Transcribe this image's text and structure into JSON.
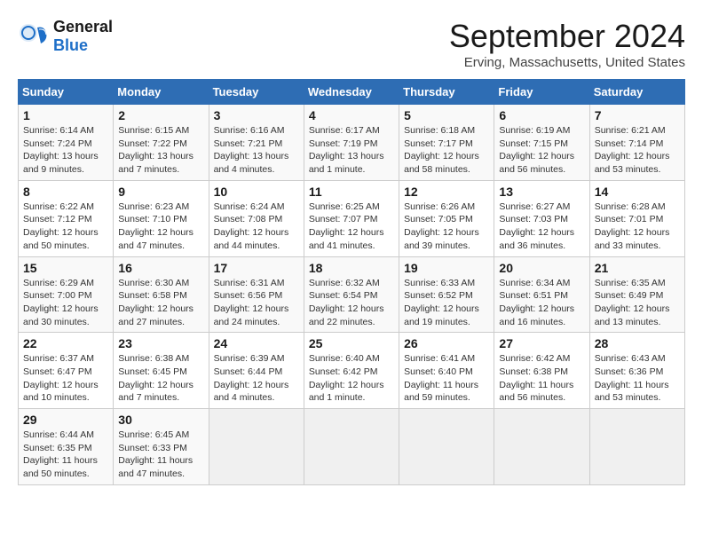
{
  "header": {
    "logo_general": "General",
    "logo_blue": "Blue",
    "month_title": "September 2024",
    "location": "Erving, Massachusetts, United States"
  },
  "days_of_week": [
    "Sunday",
    "Monday",
    "Tuesday",
    "Wednesday",
    "Thursday",
    "Friday",
    "Saturday"
  ],
  "weeks": [
    [
      {
        "num": "1",
        "sunrise": "6:14 AM",
        "sunset": "7:24 PM",
        "daylight": "13 hours and 9 minutes."
      },
      {
        "num": "2",
        "sunrise": "6:15 AM",
        "sunset": "7:22 PM",
        "daylight": "13 hours and 7 minutes."
      },
      {
        "num": "3",
        "sunrise": "6:16 AM",
        "sunset": "7:21 PM",
        "daylight": "13 hours and 4 minutes."
      },
      {
        "num": "4",
        "sunrise": "6:17 AM",
        "sunset": "7:19 PM",
        "daylight": "13 hours and 1 minute."
      },
      {
        "num": "5",
        "sunrise": "6:18 AM",
        "sunset": "7:17 PM",
        "daylight": "12 hours and 58 minutes."
      },
      {
        "num": "6",
        "sunrise": "6:19 AM",
        "sunset": "7:15 PM",
        "daylight": "12 hours and 56 minutes."
      },
      {
        "num": "7",
        "sunrise": "6:21 AM",
        "sunset": "7:14 PM",
        "daylight": "12 hours and 53 minutes."
      }
    ],
    [
      {
        "num": "8",
        "sunrise": "6:22 AM",
        "sunset": "7:12 PM",
        "daylight": "12 hours and 50 minutes."
      },
      {
        "num": "9",
        "sunrise": "6:23 AM",
        "sunset": "7:10 PM",
        "daylight": "12 hours and 47 minutes."
      },
      {
        "num": "10",
        "sunrise": "6:24 AM",
        "sunset": "7:08 PM",
        "daylight": "12 hours and 44 minutes."
      },
      {
        "num": "11",
        "sunrise": "6:25 AM",
        "sunset": "7:07 PM",
        "daylight": "12 hours and 41 minutes."
      },
      {
        "num": "12",
        "sunrise": "6:26 AM",
        "sunset": "7:05 PM",
        "daylight": "12 hours and 39 minutes."
      },
      {
        "num": "13",
        "sunrise": "6:27 AM",
        "sunset": "7:03 PM",
        "daylight": "12 hours and 36 minutes."
      },
      {
        "num": "14",
        "sunrise": "6:28 AM",
        "sunset": "7:01 PM",
        "daylight": "12 hours and 33 minutes."
      }
    ],
    [
      {
        "num": "15",
        "sunrise": "6:29 AM",
        "sunset": "7:00 PM",
        "daylight": "12 hours and 30 minutes."
      },
      {
        "num": "16",
        "sunrise": "6:30 AM",
        "sunset": "6:58 PM",
        "daylight": "12 hours and 27 minutes."
      },
      {
        "num": "17",
        "sunrise": "6:31 AM",
        "sunset": "6:56 PM",
        "daylight": "12 hours and 24 minutes."
      },
      {
        "num": "18",
        "sunrise": "6:32 AM",
        "sunset": "6:54 PM",
        "daylight": "12 hours and 22 minutes."
      },
      {
        "num": "19",
        "sunrise": "6:33 AM",
        "sunset": "6:52 PM",
        "daylight": "12 hours and 19 minutes."
      },
      {
        "num": "20",
        "sunrise": "6:34 AM",
        "sunset": "6:51 PM",
        "daylight": "12 hours and 16 minutes."
      },
      {
        "num": "21",
        "sunrise": "6:35 AM",
        "sunset": "6:49 PM",
        "daylight": "12 hours and 13 minutes."
      }
    ],
    [
      {
        "num": "22",
        "sunrise": "6:37 AM",
        "sunset": "6:47 PM",
        "daylight": "12 hours and 10 minutes."
      },
      {
        "num": "23",
        "sunrise": "6:38 AM",
        "sunset": "6:45 PM",
        "daylight": "12 hours and 7 minutes."
      },
      {
        "num": "24",
        "sunrise": "6:39 AM",
        "sunset": "6:44 PM",
        "daylight": "12 hours and 4 minutes."
      },
      {
        "num": "25",
        "sunrise": "6:40 AM",
        "sunset": "6:42 PM",
        "daylight": "12 hours and 1 minute."
      },
      {
        "num": "26",
        "sunrise": "6:41 AM",
        "sunset": "6:40 PM",
        "daylight": "11 hours and 59 minutes."
      },
      {
        "num": "27",
        "sunrise": "6:42 AM",
        "sunset": "6:38 PM",
        "daylight": "11 hours and 56 minutes."
      },
      {
        "num": "28",
        "sunrise": "6:43 AM",
        "sunset": "6:36 PM",
        "daylight": "11 hours and 53 minutes."
      }
    ],
    [
      {
        "num": "29",
        "sunrise": "6:44 AM",
        "sunset": "6:35 PM",
        "daylight": "11 hours and 50 minutes."
      },
      {
        "num": "30",
        "sunrise": "6:45 AM",
        "sunset": "6:33 PM",
        "daylight": "11 hours and 47 minutes."
      },
      null,
      null,
      null,
      null,
      null
    ]
  ]
}
